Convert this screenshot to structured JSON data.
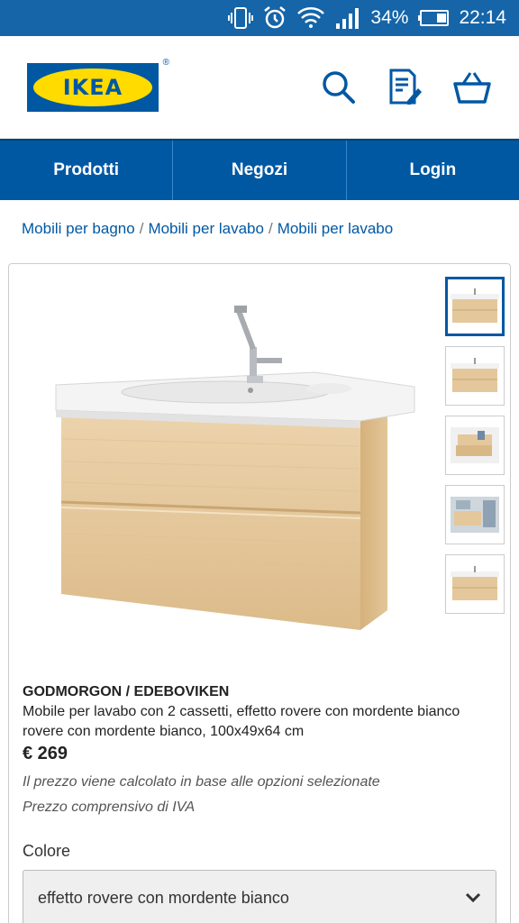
{
  "status_bar": {
    "battery": "34%",
    "time": "22:14"
  },
  "header": {
    "logo_text": "IKEA",
    "logo_reg": "®",
    "icons": [
      "search-icon",
      "shopping-list-icon",
      "basket-icon"
    ]
  },
  "nav": {
    "items": [
      {
        "label": "Prodotti"
      },
      {
        "label": "Negozi"
      },
      {
        "label": "Login"
      }
    ]
  },
  "breadcrumb": {
    "items": [
      "Mobili per bagno",
      "Mobili per lavabo",
      "Mobili per lavabo"
    ],
    "separator": "/"
  },
  "product": {
    "name": "GODMORGON / EDEBOVIKEN",
    "description": "Mobile per lavabo con 2 cassetti, effetto rovere con mordente bianco rovere con mordente bianco, 100x49x64 cm",
    "price": "€ 269",
    "price_note": "Il prezzo viene calcolato in base alle opzioni selezionate",
    "vat_note": "Prezzo comprensivo di IVA",
    "color_label": "Colore",
    "color_value": "effetto rovere con mordente bianco"
  },
  "colors": {
    "brand_blue": "#0058a3",
    "brand_yellow": "#ffdb00",
    "status_bar": "#1565a8"
  }
}
